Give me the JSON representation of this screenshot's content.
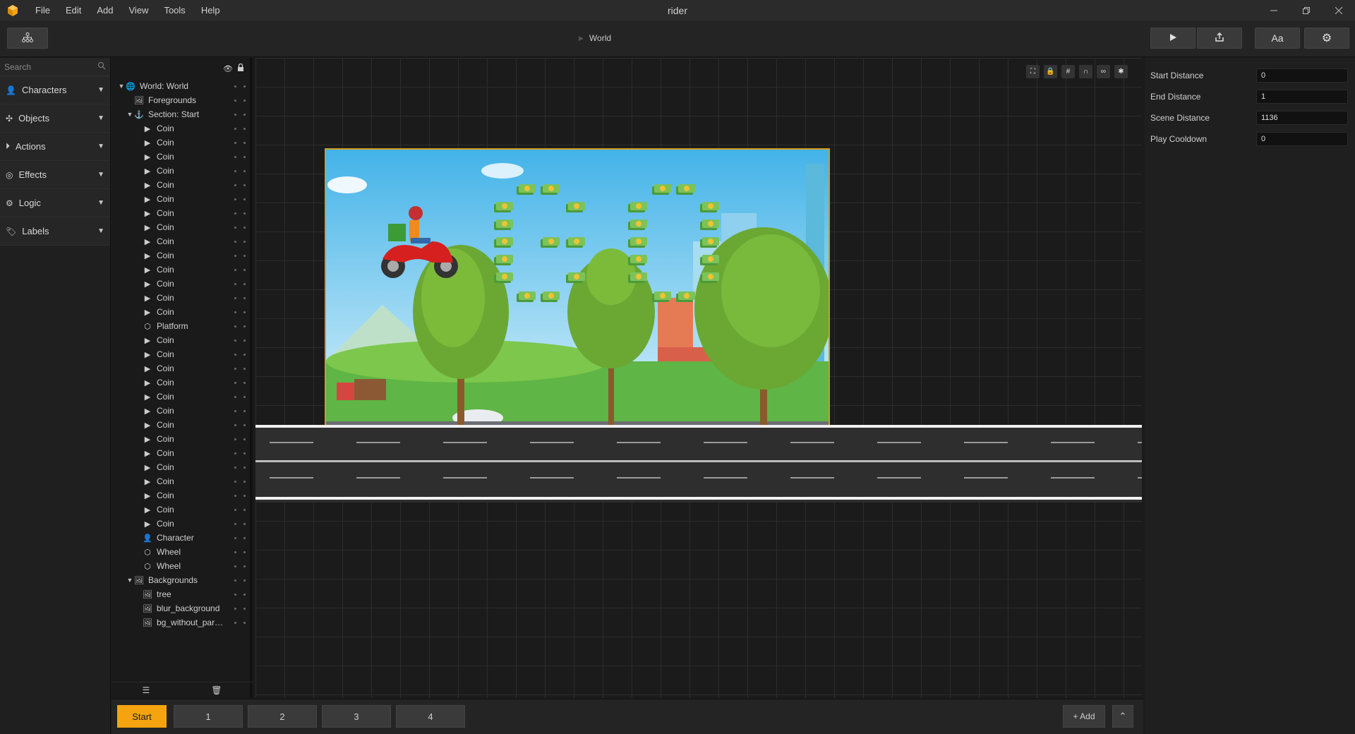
{
  "window": {
    "title": "rider"
  },
  "menu": [
    "File",
    "Edit",
    "Add",
    "View",
    "Tools",
    "Help"
  ],
  "breadcrumb": {
    "label": "World"
  },
  "search": {
    "placeholder": "Search"
  },
  "categories": [
    {
      "label": "Characters",
      "icon": "person-icon"
    },
    {
      "label": "Objects",
      "icon": "objects-icon"
    },
    {
      "label": "Actions",
      "icon": "play-circle-icon"
    },
    {
      "label": "Effects",
      "icon": "spiral-icon"
    },
    {
      "label": "Logic",
      "icon": "logic-icon"
    },
    {
      "label": "Labels",
      "icon": "tag-icon"
    }
  ],
  "tree": [
    {
      "label": "World: World",
      "icon": "globe",
      "level": 0,
      "expand": "open"
    },
    {
      "label": "Foregrounds",
      "icon": "image",
      "level": 1,
      "expand": "none"
    },
    {
      "label": "Section: Start",
      "icon": "section",
      "level": 1,
      "expand": "open"
    },
    {
      "label": "Coin",
      "icon": "play",
      "level": 2,
      "expand": "none"
    },
    {
      "label": "Coin",
      "icon": "play",
      "level": 2,
      "expand": "none"
    },
    {
      "label": "Coin",
      "icon": "play",
      "level": 2,
      "expand": "none"
    },
    {
      "label": "Coin",
      "icon": "play",
      "level": 2,
      "expand": "none"
    },
    {
      "label": "Coin",
      "icon": "play",
      "level": 2,
      "expand": "none"
    },
    {
      "label": "Coin",
      "icon": "play",
      "level": 2,
      "expand": "none"
    },
    {
      "label": "Coin",
      "icon": "play",
      "level": 2,
      "expand": "none"
    },
    {
      "label": "Coin",
      "icon": "play",
      "level": 2,
      "expand": "none"
    },
    {
      "label": "Coin",
      "icon": "play",
      "level": 2,
      "expand": "none"
    },
    {
      "label": "Coin",
      "icon": "play",
      "level": 2,
      "expand": "none"
    },
    {
      "label": "Coin",
      "icon": "play",
      "level": 2,
      "expand": "none"
    },
    {
      "label": "Coin",
      "icon": "play",
      "level": 2,
      "expand": "none"
    },
    {
      "label": "Coin",
      "icon": "play",
      "level": 2,
      "expand": "none"
    },
    {
      "label": "Coin",
      "icon": "play",
      "level": 2,
      "expand": "none"
    },
    {
      "label": "Platform",
      "icon": "hex",
      "level": 2,
      "expand": "none"
    },
    {
      "label": "Coin",
      "icon": "play",
      "level": 2,
      "expand": "none"
    },
    {
      "label": "Coin",
      "icon": "play",
      "level": 2,
      "expand": "none"
    },
    {
      "label": "Coin",
      "icon": "play",
      "level": 2,
      "expand": "none"
    },
    {
      "label": "Coin",
      "icon": "play",
      "level": 2,
      "expand": "none"
    },
    {
      "label": "Coin",
      "icon": "play",
      "level": 2,
      "expand": "none"
    },
    {
      "label": "Coin",
      "icon": "play",
      "level": 2,
      "expand": "none"
    },
    {
      "label": "Coin",
      "icon": "play",
      "level": 2,
      "expand": "none"
    },
    {
      "label": "Coin",
      "icon": "play",
      "level": 2,
      "expand": "none"
    },
    {
      "label": "Coin",
      "icon": "play",
      "level": 2,
      "expand": "none"
    },
    {
      "label": "Coin",
      "icon": "play",
      "level": 2,
      "expand": "none"
    },
    {
      "label": "Coin",
      "icon": "play",
      "level": 2,
      "expand": "none"
    },
    {
      "label": "Coin",
      "icon": "play",
      "level": 2,
      "expand": "none"
    },
    {
      "label": "Coin",
      "icon": "play",
      "level": 2,
      "expand": "none"
    },
    {
      "label": "Coin",
      "icon": "play",
      "level": 2,
      "expand": "none"
    },
    {
      "label": "Character",
      "icon": "person",
      "level": 2,
      "expand": "none"
    },
    {
      "label": "Wheel",
      "icon": "hex",
      "level": 2,
      "expand": "none"
    },
    {
      "label": "Wheel",
      "icon": "hex",
      "level": 2,
      "expand": "none"
    },
    {
      "label": "Backgrounds",
      "icon": "image",
      "level": 1,
      "expand": "open"
    },
    {
      "label": "tree",
      "icon": "image",
      "level": 2,
      "expand": "none"
    },
    {
      "label": "blur_background",
      "icon": "image",
      "level": 2,
      "expand": "none"
    },
    {
      "label": "bg_without_par…",
      "icon": "image",
      "level": 2,
      "expand": "none"
    }
  ],
  "inspector": {
    "fields": [
      {
        "label": "Start Distance",
        "value": "0"
      },
      {
        "label": "End Distance",
        "value": "1"
      },
      {
        "label": "Scene Distance",
        "value": "1136"
      },
      {
        "label": "Play Cooldown",
        "value": "0"
      }
    ]
  },
  "scene_tabs": [
    "Start",
    "1",
    "2",
    "3",
    "4"
  ],
  "bottom": {
    "add_label": "+ Add"
  },
  "toolbar": {
    "font_label": "Aa"
  },
  "colors": {
    "accent": "#f5a40f",
    "bg": "#1b1b1b"
  }
}
